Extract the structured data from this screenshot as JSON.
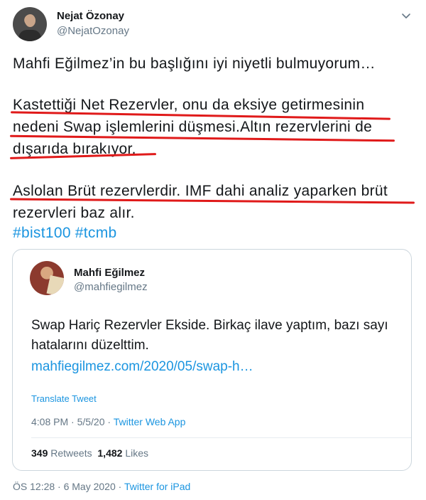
{
  "author": {
    "name": "Nejat Özonay",
    "handle": "@NejatOzonay"
  },
  "tweet": {
    "line1": "Mahfi Eğilmez’in bu başlığını iyi niyetli bulmuyorum…",
    "line2": "Kastettiği Net Rezervler, onu da eksiye getirmesinin",
    "line3": "nedeni Swap işlemlerini düşmesi.Altın rezervlerini de",
    "line4": "dışarıda bırakıyor.",
    "line5": "Aslolan Brüt rezervlerdir. IMF dahi analiz yaparken brüt",
    "line6": "rezervleri baz alır.",
    "hashtags": [
      "#bist100",
      "#tcmb"
    ]
  },
  "quote": {
    "name": "Mahfi Eğilmez",
    "handle": "@mahfiegilmez",
    "line1": "Swap Hariç Rezervler Ekside. Birkaç ilave yaptım, bazı sayı",
    "line2": "hatalarını düzelttim.",
    "link": "mahfiegilmez.com/2020/05/swap-h…",
    "translate": "Translate Tweet",
    "time": "4:08 PM · 5/5/20 · ",
    "source": "Twitter Web App",
    "retweets_count": "349",
    "retweets_label": "Retweets",
    "likes_count": "1,482",
    "likes_label": "Likes"
  },
  "footer": {
    "time": "ÖS 12:28 · 6 May 2020 · ",
    "source": "Twitter for iPad"
  },
  "colors": {
    "link": "#1b95e0",
    "muted": "#657786",
    "annotation": "#e01a1a"
  },
  "icons": {
    "menu": "chevron-down-icon"
  }
}
